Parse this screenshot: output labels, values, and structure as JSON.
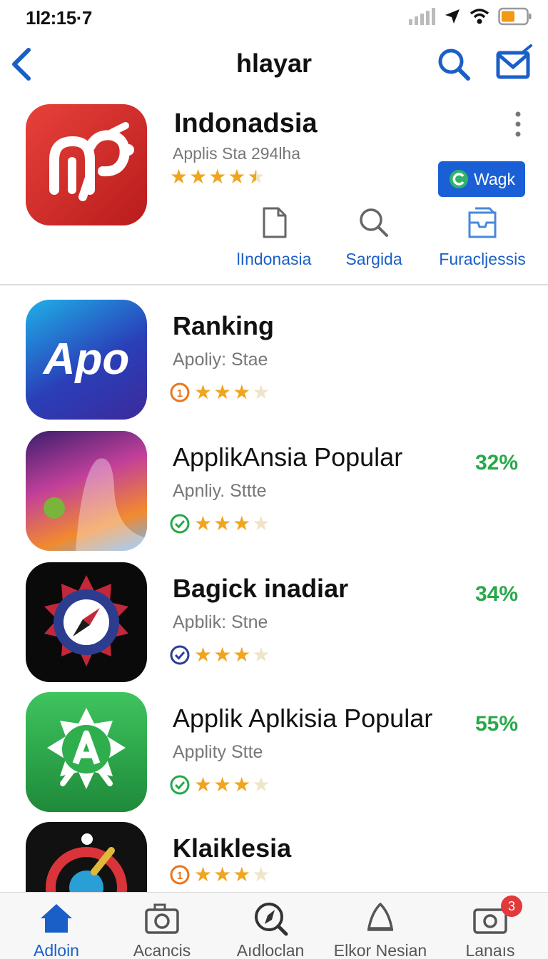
{
  "status_bar": {
    "time": "1l2:15·7",
    "icons": [
      "signal-icon",
      "location-icon",
      "wifi-icon",
      "battery-icon"
    ]
  },
  "nav": {
    "title": "hlayar",
    "back_icon": "chevron-left-icon",
    "search_icon": "search-icon",
    "mail_icon": "mail-icon"
  },
  "featured": {
    "name": "Indonadsia",
    "subtitle": "Applis Sta 294lha",
    "rating": 4.5,
    "button_label": "Wagk",
    "actions": [
      {
        "label": "lIndonasia",
        "icon": "document-icon"
      },
      {
        "label": "Sargida",
        "icon": "search-icon"
      },
      {
        "label": "Furacljessis",
        "icon": "inbox-icon"
      }
    ]
  },
  "list": [
    {
      "name": "Ranking",
      "subtitle": "Apoliy: Stae",
      "icon_text": "Apo",
      "rating": 3.5,
      "percent": "",
      "badge": "rank-badge-icon"
    },
    {
      "name": "ApplikAnsia Popular",
      "subtitle": "Apnliy. Sttte",
      "rating": 3.5,
      "percent": "32%",
      "badge": "check-badge-icon"
    },
    {
      "name": "Bagick inadiar",
      "subtitle": "Apblik: Stne",
      "rating": 3.5,
      "percent": "34%",
      "badge": "check-badge-icon"
    },
    {
      "name": "Applik Aplkisia Popular",
      "subtitle": "Applity Stte",
      "rating": 3.5,
      "percent": "55%",
      "badge": "check-badge-icon"
    },
    {
      "name": "Klaiklesia",
      "subtitle": "",
      "rating": 3.5,
      "percent": "",
      "badge": "rank-badge-icon"
    }
  ],
  "tabbar": {
    "tabs": [
      {
        "label": "Adloin",
        "icon": "home-icon",
        "active": true
      },
      {
        "label": "Acancis",
        "icon": "camera-icon",
        "active": false
      },
      {
        "label": "Aıdloclan",
        "icon": "compass-icon",
        "active": false
      },
      {
        "label": "Elkor Nesian",
        "icon": "bell-icon",
        "active": false
      },
      {
        "label": "Lanaıs",
        "icon": "photo-icon",
        "active": false,
        "badge": "3"
      }
    ]
  },
  "colors": {
    "accent": "#1a5fc8",
    "button": "#1a5fd6",
    "star": "#f0a520",
    "percent": "#27a84a",
    "notification": "#e23a3a"
  }
}
